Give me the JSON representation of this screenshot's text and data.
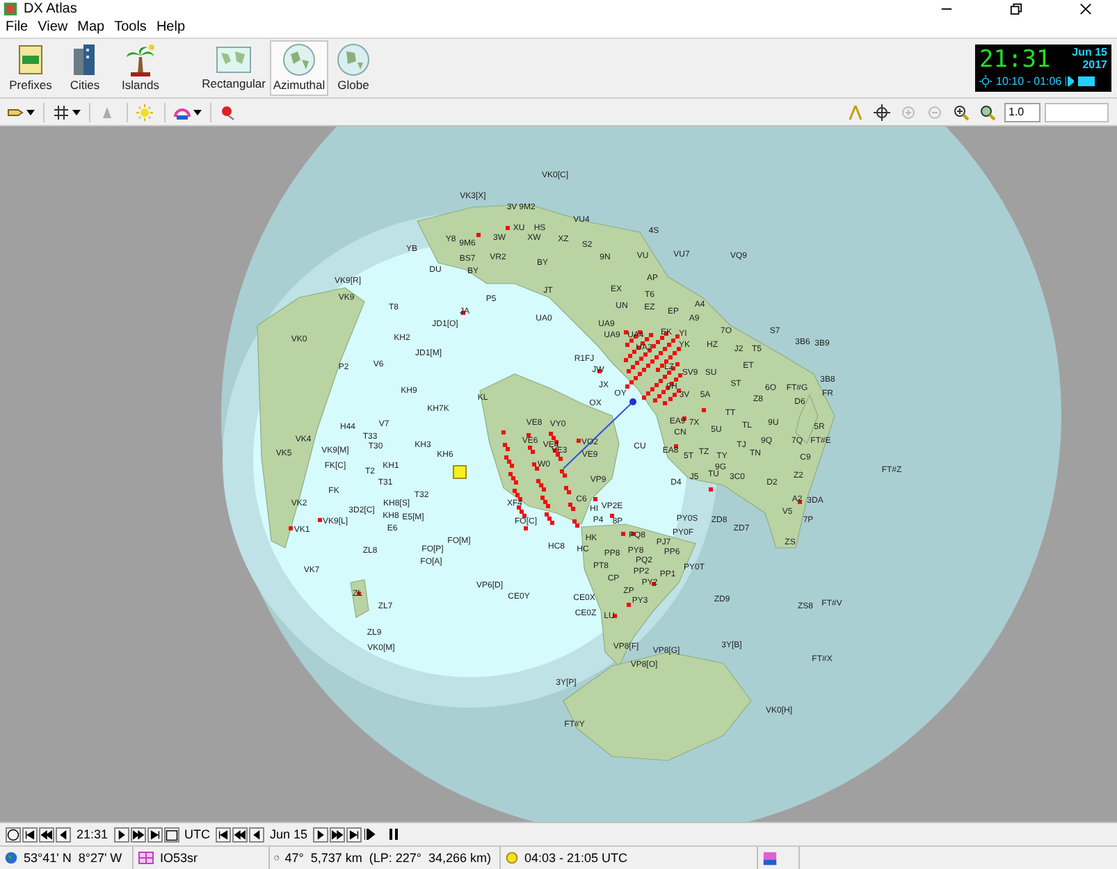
{
  "window": {
    "title": "DX Atlas"
  },
  "menu": [
    "File",
    "View",
    "Map",
    "Tools",
    "Help"
  ],
  "toolbar": {
    "buttons": [
      {
        "label": "Prefixes",
        "kind": "prefixes",
        "selected": false
      },
      {
        "label": "Cities",
        "kind": "cities",
        "selected": false
      },
      {
        "label": "Islands",
        "kind": "islands",
        "selected": false
      },
      {
        "label": "Rectangular",
        "kind": "rectangular",
        "selected": false
      },
      {
        "label": "Azimuthal",
        "kind": "azimuthal",
        "selected": true
      },
      {
        "label": "Globe",
        "kind": "globe",
        "selected": false
      }
    ]
  },
  "clock": {
    "time": "21:31",
    "date": "Jun 15",
    "year": "2017",
    "sun_times": "10:10 - 01:06"
  },
  "zoom_field": {
    "value": "1.0"
  },
  "map": {
    "labels": [
      "VK0[C]",
      "VK3[X]",
      "3V",
      "9M2",
      "VU4",
      "XU",
      "HS",
      "4S",
      "Y8",
      "3W",
      "XW",
      "XZ",
      "9M6",
      "S2",
      "YB",
      "BS7",
      "VR2",
      "9N",
      "VU",
      "VU7",
      "VQ9",
      "BY",
      "DU",
      "BY",
      "VK9[R]",
      "AP",
      "JT",
      "EX",
      "VK9",
      "P5",
      "T6",
      "T8",
      "UN",
      "EZ",
      "A4",
      "JA",
      "EP",
      "UA0",
      "A9",
      "JD1[O]",
      "UA9",
      "UA9",
      "UA4",
      "EK",
      "YI",
      "7O",
      "S7",
      "VK0",
      "KH2",
      "YK",
      "HZ",
      "3B6",
      "3B9",
      "UA3",
      "J2",
      "T5",
      "JD1[M]",
      "R1FJ",
      "P2",
      "V6",
      "LZ",
      "ET",
      "JW",
      "SV9",
      "SU",
      "3B8",
      "KH9",
      "JX",
      "9H",
      "ST",
      "6O",
      "FT#G",
      "OY",
      "3V",
      "5A",
      "FR",
      "KL",
      "OX",
      "Z8",
      "D6",
      "KH7K",
      "TT",
      "H44",
      "V7",
      "VE8",
      "VY0",
      "EA9",
      "7X",
      "TL",
      "9U",
      "5R",
      "CN",
      "5U",
      "VK4",
      "T33",
      "VE6",
      "VO2",
      "9Q",
      "7Q",
      "FT#E",
      "T30",
      "KH3",
      "VE4",
      "CU",
      "TJ",
      "VK5",
      "VK9[M]",
      "KH6",
      "VE3",
      "VE9",
      "EA8",
      "5T",
      "TZ",
      "TY",
      "TN",
      "C9",
      "FK[C]",
      "T2",
      "KH1",
      "W0",
      "9G",
      "FT#Z",
      "T31",
      "VP9",
      "D4",
      "J5",
      "TU",
      "3C0",
      "D2",
      "Z2",
      "FK",
      "T32",
      "VK2",
      "KH8[S]",
      "XF4",
      "C6",
      "VP2E",
      "A2",
      "3DA",
      "3D2[C]",
      "HI",
      "V5",
      "VK9[L]",
      "KH8",
      "E5[M]",
      "FO[C]",
      "P4",
      "8P",
      "PY0S",
      "ZD8",
      "7P",
      "VK1",
      "E6",
      "ZD7",
      "HK",
      "PQ8",
      "PY0F",
      "FO[M]",
      "PJ7",
      "ZS",
      "ZL8",
      "FO[P]",
      "HC8",
      "HC",
      "PP8",
      "PY8",
      "PP6",
      "FO[A]",
      "PQ2",
      "PT8",
      "PY0T",
      "VK7",
      "PP2",
      "PP1",
      "CP",
      "VP6[D]",
      "PY2",
      "ZL",
      "ZP",
      "CE0Y",
      "CE0X",
      "PY3",
      "ZD9",
      "ZL7",
      "ZS8",
      "FT#V",
      "CE0Z",
      "LU",
      "ZL9",
      "VK0[M]",
      "VP8[F]",
      "VP8[G]",
      "3Y[B]",
      "VP8[O]",
      "FT#X",
      "3Y[P]",
      "VK0[H]",
      "FT#Y"
    ]
  },
  "time_bar": {
    "time": "21:31",
    "zone": "UTC",
    "date": "Jun 15"
  },
  "status_bar": [
    {
      "kind": "location",
      "text": "53°41' N  8°27' W"
    },
    {
      "kind": "grid",
      "text": "IO53sr"
    },
    {
      "kind": "bearing",
      "text": "47°  5,737 km  (LP: 227°  34,266 km)"
    },
    {
      "kind": "sun",
      "text": "04:03 - 21:05 UTC"
    }
  ]
}
